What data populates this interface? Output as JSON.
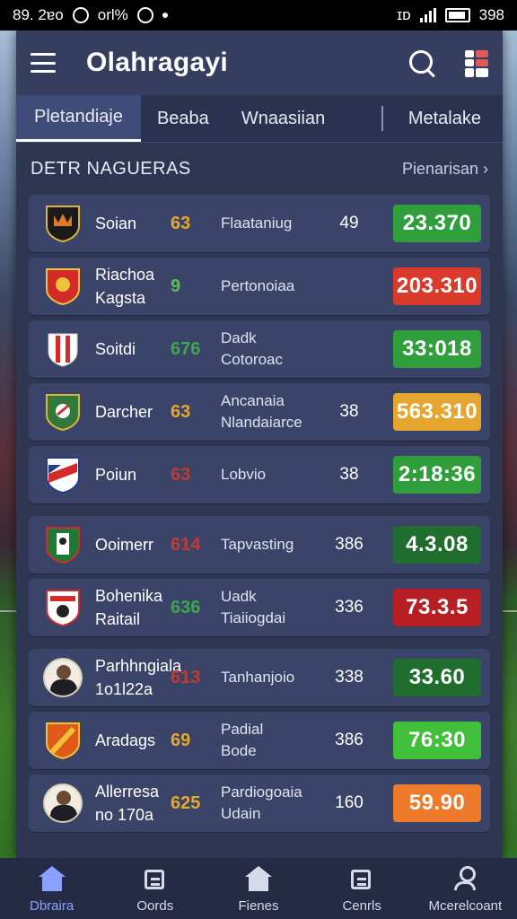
{
  "status_bar": {
    "time": "89. 2ɐo",
    "app_text": "orl%",
    "right_icon_text": "ɪᴅ",
    "battery_text": "398"
  },
  "header": {
    "title": "Olahragayi"
  },
  "tabs": [
    {
      "label": "Pletandiaje",
      "active": true
    },
    {
      "label": "Beaba",
      "active": false
    },
    {
      "label": "Wnaasiian",
      "active": false
    },
    {
      "label": "Metalake",
      "active": false
    }
  ],
  "section": {
    "title": "DETR NAGUERAS",
    "link": "Pienarisan ›"
  },
  "rows": [
    {
      "team": "Soian",
      "team2": "",
      "form": "63",
      "form_color": "#e5a82a",
      "match": "Flaataniug",
      "match2": "",
      "pts": "49",
      "score": "23.370",
      "score_color": "#2f9e3b",
      "badge": "b1"
    },
    {
      "team": "Riachoa",
      "team2": "Kagsta",
      "form": "9",
      "form_color": "#5bc04a",
      "match": "Pertonoiaa",
      "match2": "",
      "pts": "",
      "score": "203.310",
      "score_color": "#d93a2a",
      "badge": "b2"
    },
    {
      "team": "Soitdi",
      "team2": "",
      "form": "676",
      "form_color": "#3ea84a",
      "match": "Dadk",
      "match2": "Cotoroac",
      "pts": "",
      "score": "33:018",
      "score_color": "#2f9e3b",
      "badge": "b3"
    },
    {
      "team": "Darcher",
      "team2": "",
      "form": "63",
      "form_color": "#e5a82a",
      "match": "Ancanaia",
      "match2": "Nlandaiarce",
      "pts": "38",
      "score": "563.310",
      "score_color": "#e5a52e",
      "badge": "b4"
    },
    {
      "team": "Poiun",
      "team2": "",
      "form": "63",
      "form_color": "#c43a2e",
      "match": "Lobvio",
      "match2": "",
      "pts": "38",
      "score": "2:18:36",
      "score_color": "#2f9e3b",
      "badge": "b5"
    },
    {
      "team": "Ooimerr",
      "team2": "",
      "form": "614",
      "form_color": "#c43a2e",
      "match": "Tapvasting",
      "match2": "",
      "pts": "386",
      "score": "4.3.08",
      "score_color": "#1f6e2e",
      "badge": "b6",
      "gap": true
    },
    {
      "team": "Bohenika",
      "team2": "Raitail",
      "form": "636",
      "form_color": "#3ea84a",
      "match": "Uadk",
      "match2": "Tiaiiogdai",
      "pts": "336",
      "score": "73.3.5",
      "score_color": "#b81f24",
      "badge": "b7"
    },
    {
      "team": "Parhhngiala",
      "team2": "1o1l22a",
      "form": "613",
      "form_color": "#c43a2e",
      "match": "Tanhanjoio",
      "match2": "",
      "pts": "338",
      "score": "33.60",
      "score_color": "#1f6e2e",
      "badge": "avatar",
      "gap": true
    },
    {
      "team": "Aradags",
      "team2": "",
      "form": "69",
      "form_color": "#e5a82a",
      "match": "Padial",
      "match2": "Bode",
      "pts": "386",
      "score": "76:30",
      "score_color": "#3fbf3a",
      "badge": "b9"
    },
    {
      "team": "Allerresa",
      "team2": "no 170a",
      "form": "625",
      "form_color": "#e5a82a",
      "match": "Pardiogoaia",
      "match2": "Udain",
      "pts": "160",
      "score": "59.90",
      "score_color": "#ee7a2b",
      "badge": "avatar"
    }
  ],
  "bottom_nav": [
    {
      "label": "Dbraira",
      "icon": "home-icon",
      "active": true
    },
    {
      "label": "Oords",
      "icon": "cards-icon",
      "active": false
    },
    {
      "label": "Fienes",
      "icon": "home-icon",
      "active": false
    },
    {
      "label": "Cenrls",
      "icon": "edit-icon",
      "active": false
    },
    {
      "label": "Mcerelcoant",
      "icon": "user-icon",
      "active": false
    }
  ]
}
